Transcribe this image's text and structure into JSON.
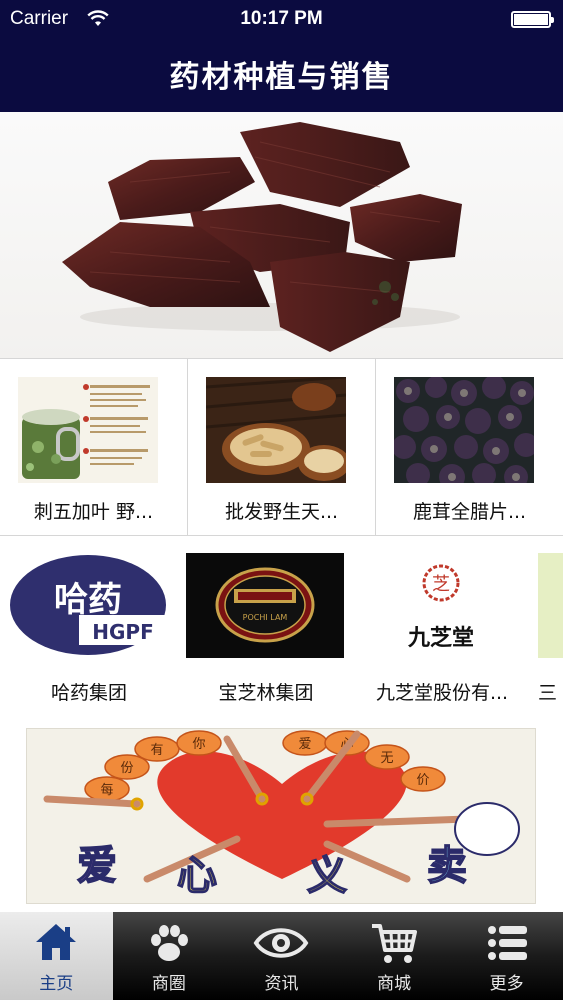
{
  "status_bar": {
    "carrier": "Carrier",
    "time": "10:17 PM"
  },
  "nav": {
    "title": "药材种植与销售"
  },
  "products": [
    {
      "label": "刺五加叶 野..."
    },
    {
      "label": "批发野生天..."
    },
    {
      "label": "鹿茸全腊片..."
    }
  ],
  "brands": [
    {
      "label": "哈药集团",
      "logo_text": "哈药",
      "logo_sub": "HGPF"
    },
    {
      "label": "宝芝林集团",
      "logo_text": "POCHI LAM"
    },
    {
      "label": "九芝堂股份有...",
      "logo_text": "九芝堂",
      "seal_text": "芝"
    },
    {
      "label": "三"
    }
  ],
  "banner": {
    "words": [
      "爱",
      "心",
      "义",
      "卖"
    ],
    "ring": [
      "每",
      "份",
      "有",
      "你",
      "爱",
      "心",
      "无",
      "价"
    ]
  },
  "tabs": [
    {
      "label": "主页",
      "icon": "home-icon",
      "active": true
    },
    {
      "label": "商圈",
      "icon": "paw-icon",
      "active": false
    },
    {
      "label": "资讯",
      "icon": "eye-icon",
      "active": false
    },
    {
      "label": "商城",
      "icon": "cart-icon",
      "active": false
    },
    {
      "label": "更多",
      "icon": "list-icon",
      "active": false
    }
  ],
  "colors": {
    "nav_bg": "#0b0b40",
    "tab_active_text": "#1a3e86",
    "tabbar_bg": "#1b1b1b"
  }
}
